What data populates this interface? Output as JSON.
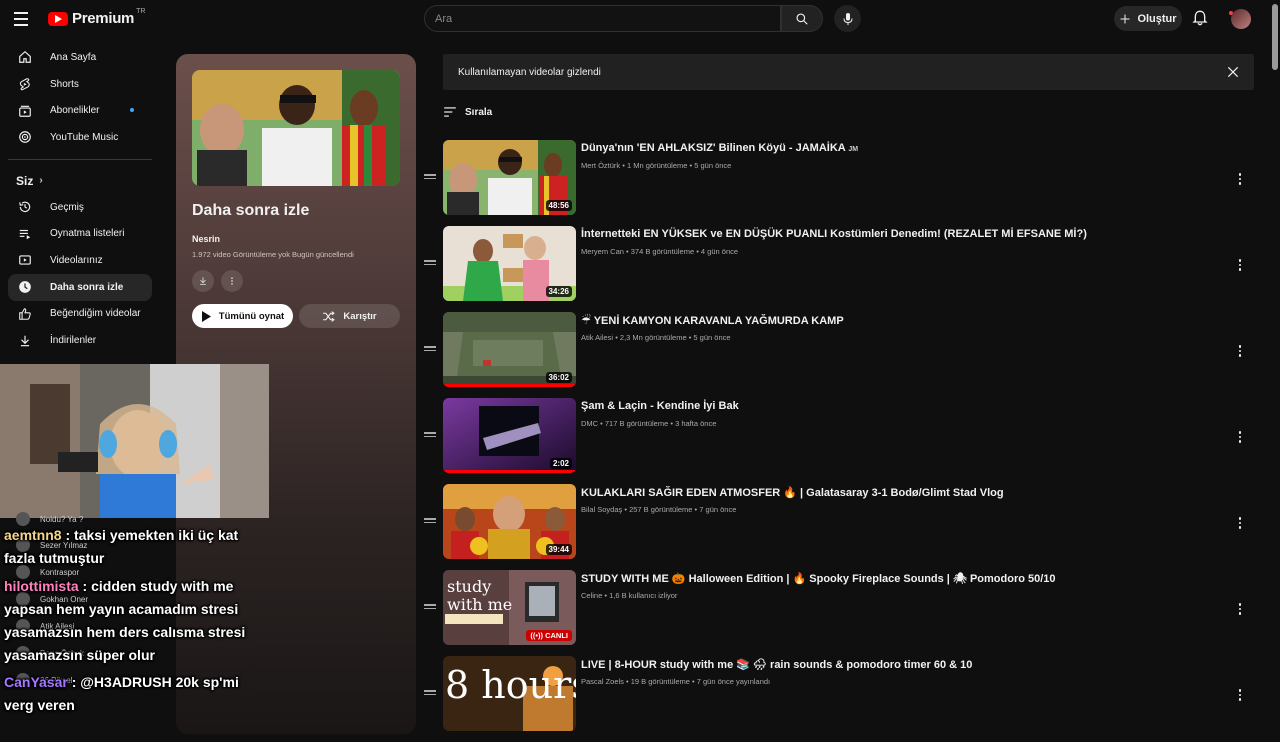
{
  "header": {
    "logo_text": "Premium",
    "logo_region": "TR",
    "search_placeholder": "Ara",
    "create_label": "Oluştur"
  },
  "sidebar": {
    "items": [
      {
        "label": "Ana Sayfa",
        "icon": "home-icon"
      },
      {
        "label": "Shorts",
        "icon": "shorts-icon"
      },
      {
        "label": "Abonelikler",
        "icon": "subscriptions-icon"
      },
      {
        "label": "YouTube Music",
        "icon": "music-icon"
      }
    ],
    "you_heading": "Siz",
    "you_items": [
      {
        "label": "Geçmiş",
        "icon": "history-icon"
      },
      {
        "label": "Oynatma listeleri",
        "icon": "playlists-icon"
      },
      {
        "label": "Videolarınız",
        "icon": "your-videos-icon"
      },
      {
        "label": "Daha sonra izle",
        "icon": "watch-later-icon",
        "active": true
      },
      {
        "label": "Beğendiğim videolar",
        "icon": "like-icon"
      },
      {
        "label": "İndirilenler",
        "icon": "download-icon"
      }
    ]
  },
  "playlist": {
    "title": "Daha sonra izle",
    "owner": "Nesrin",
    "meta": "1.972 video  Görüntüleme yok  Bugün güncellendi",
    "play_all_label": "Tümünü oynat",
    "shuffle_label": "Karıştır"
  },
  "notice": {
    "text": "Kullanılamayan videolar gizlendi"
  },
  "sort_label": "Sırala",
  "videos": [
    {
      "title": "Dünya'nın 'EN AHLAKSIZ' Bilinen Köyü - JAMAİKA",
      "title_suffix": "JM",
      "channel": "Mert Öztürk",
      "views": "1 Mn görüntüleme",
      "age": "5 gün önce",
      "duration": "48:56",
      "progress": 0.0
    },
    {
      "title": "İnternetteki EN YÜKSEK ve EN DÜŞÜK PUANLI Kostümleri Denedim! (REZALET Mİ EFSANE Mİ?)",
      "channel": "Meryem Can",
      "views": "374 B görüntüleme",
      "age": "4 gün önce",
      "duration": "34:26",
      "progress": 0.0
    },
    {
      "title": "☔ YENİ KAMYON KARAVANLA YAĞMURDA KAMP",
      "channel": "Atik Ailesi",
      "views": "2,3 Mn görüntüleme",
      "age": "5 gün önce",
      "duration": "36:02",
      "progress": 1.0
    },
    {
      "title": "Şam & Laçin - Kendine İyi Bak",
      "channel": "DMC",
      "views": "717 B görüntüleme",
      "age": "3 hafta önce",
      "duration": "2:02",
      "progress": 1.0
    },
    {
      "title": "KULAKLARI SAĞIR EDEN ATMOSFER 🔥 | Galatasaray 3-1 Bodø/Glimt Stad Vlog",
      "channel": "Bilal Soydaş",
      "views": "257 B görüntüleme",
      "age": "7 gün önce",
      "duration": "39:44",
      "progress": 0.0
    },
    {
      "title": "STUDY WITH ME 🎃 Halloween Edition | 🔥 Spooky Fireplace Sounds | 🕷 Pomodoro 50/10",
      "channel": "Celine",
      "views": "1,6 B kullanıcı izliyor",
      "age": "",
      "live_label": "CANLI",
      "progress": 0.0
    },
    {
      "title": "LIVE | 8-HOUR study with me 📚 🌧 rain sounds & pomodoro timer 60 & 10",
      "channel": "Pascal Zoels",
      "views": "19 B görüntüleme",
      "age": "7 gün önce yayınlandı",
      "duration": "",
      "progress": 0.0
    }
  ],
  "overlay_chat": {
    "underlying_names": [
      "Noldu? Ya ?",
      "Sezer Yılmaz",
      "Kontraspor",
      "Gokhan Oner",
      "Atik Ailesi",
      "Barış Özbek",
      "26 Piksel"
    ],
    "messages": [
      {
        "user": "aemtnn8",
        "text": " : taksi yemekten iki üç kat fazla tutmuştur",
        "color": "#f5d58a"
      },
      {
        "user": "hilottimista",
        "text": " : cidden study with me yapsan hem yayın acamadım stresi yasamazsın hem ders calısma stresi yasamazsın süper olur",
        "color": "#ff7fbf"
      },
      {
        "user": "CanYasar",
        "text": " : @H3ADRUSH 20k sp'mi verg veren",
        "color": "#a678ff"
      }
    ]
  },
  "colors": {
    "accent": "#ff0000",
    "background": "#0f0f0f",
    "new_dot": "#3ea6ff"
  }
}
